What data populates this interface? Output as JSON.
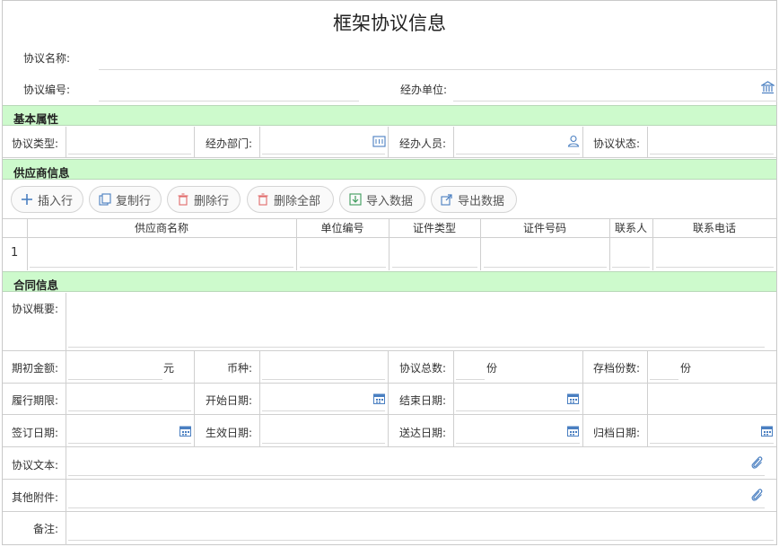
{
  "title": "框架协议信息",
  "header": {
    "agreement_name_label": "协议名称:",
    "agreement_no_label": "协议编号:",
    "handling_unit_label": "经办单位:"
  },
  "sections": {
    "basic": "基本属性",
    "supplier": "供应商信息",
    "contract": "合同信息"
  },
  "basic": {
    "type_label": "协议类型:",
    "dept_label": "经办部门:",
    "person_label": "经办人员:",
    "status_label": "协议状态:"
  },
  "toolbar": {
    "insert": "插入行",
    "copy": "复制行",
    "delete": "删除行",
    "delete_all": "删除全部",
    "import": "导入数据",
    "export": "导出数据"
  },
  "supplier_table": {
    "columns": [
      "供应商名称",
      "单位编号",
      "证件类型",
      "证件号码",
      "联系人",
      "联系电话"
    ],
    "rows": [
      {
        "index": "1",
        "cells": [
          "",
          "",
          "",
          "",
          "",
          ""
        ]
      }
    ]
  },
  "contract": {
    "summary_label": "协议概要:",
    "initial_amount_label": "期初金额:",
    "yuan_unit": "元",
    "currency_label": "币种:",
    "total_copies_label": "协议总数:",
    "fen_unit_1": "份",
    "archive_copies_label": "存档份数:",
    "fen_unit_2": "份",
    "term_label": "履行期限:",
    "start_date_label": "开始日期:",
    "end_date_label": "结束日期:",
    "sign_date_label": "签订日期:",
    "effective_date_label": "生效日期:",
    "delivery_date_label": "送达日期:",
    "archive_date_label": "归档日期:",
    "text_label": "协议文本:",
    "attachments_label": "其他附件:",
    "remark_label": "备注:"
  },
  "colors": {
    "section_bg": "#cdfacc",
    "icon_blue": "#4a7fc1",
    "border": "#cfcfcf"
  },
  "icons": [
    "bank-icon",
    "org-chart-icon",
    "person-icon",
    "calendar-icon",
    "paperclip-icon",
    "plus-icon",
    "copy-icon",
    "trash-icon",
    "import-icon",
    "export-icon"
  ]
}
